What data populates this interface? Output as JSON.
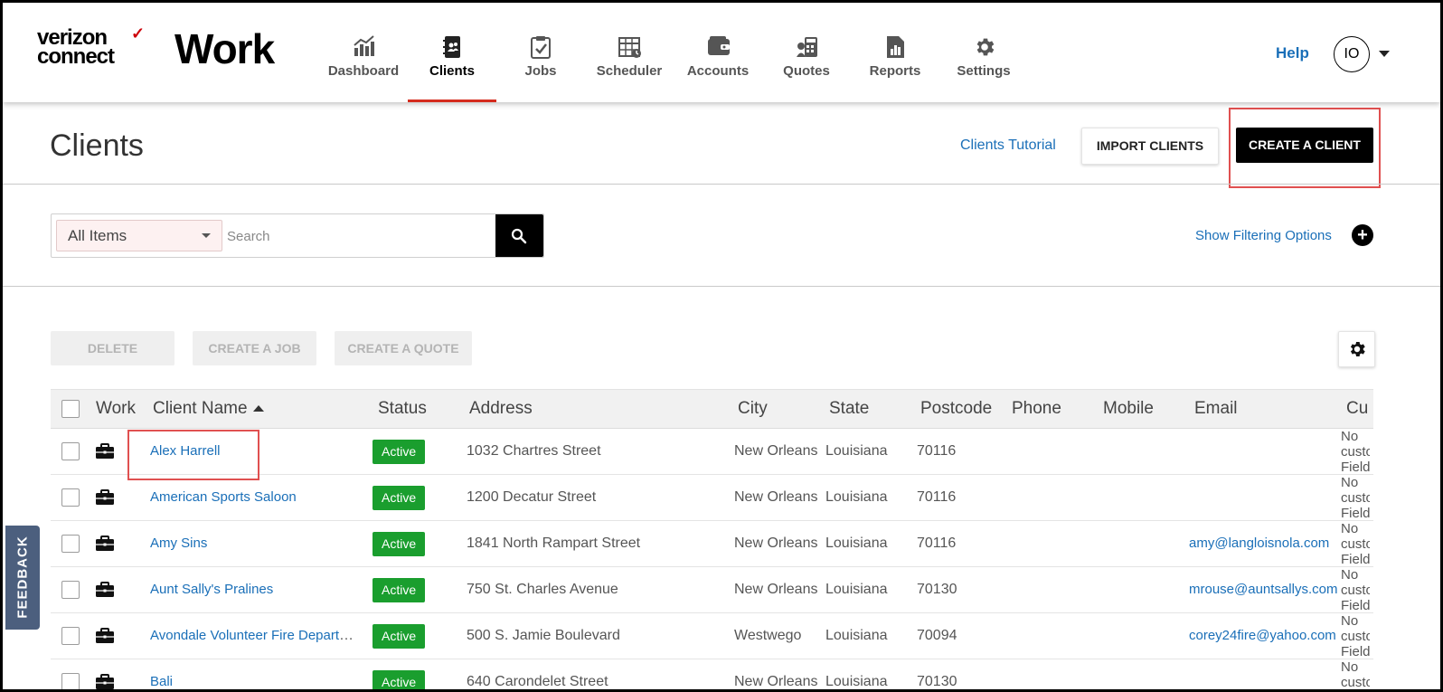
{
  "brand": {
    "line1": "verizon",
    "line2": "connect",
    "product": "Work"
  },
  "nav": [
    {
      "label": "Dashboard",
      "icon": "dashboard-icon"
    },
    {
      "label": "Clients",
      "icon": "clients-icon",
      "active": true
    },
    {
      "label": "Jobs",
      "icon": "jobs-icon"
    },
    {
      "label": "Scheduler",
      "icon": "scheduler-icon"
    },
    {
      "label": "Accounts",
      "icon": "accounts-icon"
    },
    {
      "label": "Quotes",
      "icon": "quotes-icon"
    },
    {
      "label": "Reports",
      "icon": "reports-icon"
    },
    {
      "label": "Settings",
      "icon": "settings-icon"
    }
  ],
  "header": {
    "help": "Help",
    "avatar": "IO"
  },
  "page": {
    "title": "Clients",
    "tutorial_link": "Clients Tutorial",
    "import_label": "IMPORT CLIENTS",
    "create_label": "CREATE A CLIENT"
  },
  "search": {
    "filter_value": "All Items",
    "placeholder": "Search",
    "show_filtering": "Show Filtering Options"
  },
  "actions": {
    "delete": "DELETE",
    "create_job": "CREATE A JOB",
    "create_quote": "CREATE A QUOTE"
  },
  "table": {
    "headers": {
      "work": "Work",
      "client_name": "Client Name",
      "status": "Status",
      "address": "Address",
      "city": "City",
      "state": "State",
      "postcode": "Postcode",
      "phone": "Phone",
      "mobile": "Mobile",
      "email": "Email",
      "custom": "Cu"
    },
    "rows": [
      {
        "name": "Alex Harrell",
        "status": "Active",
        "address": "1032 Chartres Street",
        "city": "New Orleans",
        "state": "Louisiana",
        "postcode": "70116",
        "phone": "",
        "mobile": "",
        "email": "",
        "custom": "No custom Fields"
      },
      {
        "name": "American Sports Saloon",
        "status": "Active",
        "address": "1200 Decatur Street",
        "city": "New Orleans",
        "state": "Louisiana",
        "postcode": "70116",
        "phone": "",
        "mobile": "",
        "email": "",
        "custom": "No custom Fields"
      },
      {
        "name": "Amy Sins",
        "status": "Active",
        "address": "1841 North Rampart Street",
        "city": "New Orleans",
        "state": "Louisiana",
        "postcode": "70116",
        "phone": "",
        "mobile": "",
        "email": "amy@langloisnola.com",
        "custom": "No custom Fields"
      },
      {
        "name": "Aunt Sally's Pralines",
        "status": "Active",
        "address": "750 St. Charles Avenue",
        "city": "New Orleans",
        "state": "Louisiana",
        "postcode": "70130",
        "phone": "",
        "mobile": "",
        "email": "mrouse@auntsallys.com",
        "custom": "No custom Fields"
      },
      {
        "name": "Avondale Volunteer Fire Department",
        "status": "Active",
        "address": "500 S. Jamie Boulevard",
        "city": "Westwego",
        "state": "Louisiana",
        "postcode": "70094",
        "phone": "",
        "mobile": "",
        "email": "corey24fire@yahoo.com",
        "custom": "No custom Fields"
      },
      {
        "name": "Bali",
        "status": "Active",
        "address": "640 Carondelet Street",
        "city": "New Orleans",
        "state": "Louisiana",
        "postcode": "70130",
        "phone": "",
        "mobile": "",
        "email": "",
        "custom": "No custom Fields"
      }
    ]
  },
  "feedback": "FEEDBACK"
}
